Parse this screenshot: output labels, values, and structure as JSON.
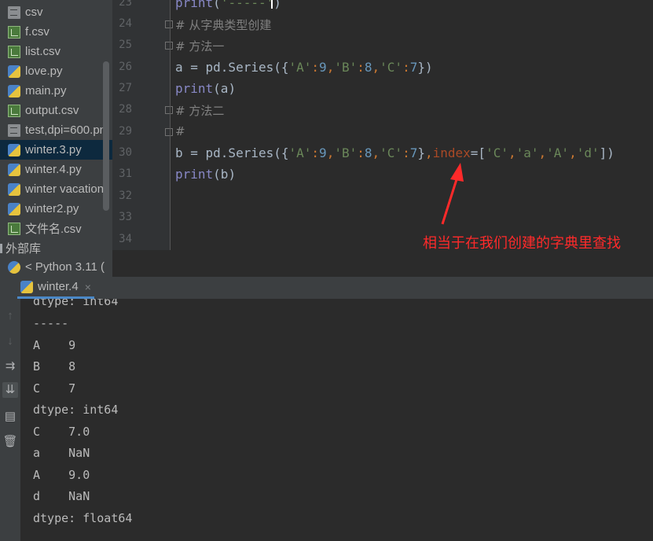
{
  "project_tree": {
    "items": [
      {
        "label": "csv",
        "icon": "csv-file-icon"
      },
      {
        "label": "f.csv",
        "icon": "csv-file-icon"
      },
      {
        "label": "list.csv",
        "icon": "csv-file-icon"
      },
      {
        "label": "love.py",
        "icon": "python-file-icon"
      },
      {
        "label": "main.py",
        "icon": "python-file-icon"
      },
      {
        "label": "output.csv",
        "icon": "csv-file-icon"
      },
      {
        "label": "test,dpi=600.pn",
        "icon": "text-file-icon"
      },
      {
        "label": "winter.3.py",
        "icon": "python-file-icon",
        "selected": true
      },
      {
        "label": "winter.4.py",
        "icon": "python-file-icon"
      },
      {
        "label": "winter vacation",
        "icon": "python-file-icon"
      },
      {
        "label": "winter2.py",
        "icon": "python-file-icon"
      },
      {
        "label": "文件名.csv",
        "icon": "csv-file-icon"
      }
    ],
    "external_libs": "外部库",
    "python_sdk": "< Python 3.11 ("
  },
  "editor": {
    "line_numbers": [
      "23",
      "24",
      "25",
      "26",
      "27",
      "28",
      "29",
      "30",
      "31",
      "32",
      "33",
      "34"
    ],
    "line23": {
      "fn": "print",
      "open": "(",
      "str": "'-----'",
      "close": ")"
    },
    "line24": "# 从字典类型创建",
    "line25": "# 方法一",
    "line26": {
      "lhs": "a = pd.Series({",
      "k1": "'A'",
      "c1": ":",
      "v1": "9",
      "s1": ",",
      "k2": "'B'",
      "c2": ":",
      "v2": "8",
      "s2": ",",
      "k3": "'C'",
      "c3": ":",
      "v3": "7",
      "end": "})"
    },
    "line27": {
      "fn": "print",
      "rest": "(a)"
    },
    "line28": "# 方法二",
    "line29": "#",
    "line30": {
      "lhs": "b = pd.Series({",
      "k1": "'A'",
      "c1": ":",
      "v1": "9",
      "s1": ",",
      "k2": "'B'",
      "c2": ":",
      "v2": "8",
      "s2": ",",
      "k3": "'C'",
      "c3": ":",
      "v3": "7",
      "mid": "}",
      "s3": ",",
      "kw": "index",
      "eq": "=[",
      "i1": "'C'",
      "t1": ",",
      "i2": "'a'",
      "t2": ",",
      "i3": "'A'",
      "t3": ",",
      "i4": "'d'",
      "end": "])"
    },
    "line31": {
      "fn": "print",
      "rest": "(b)"
    },
    "annotation": "相当于在我们创建的字典里查找",
    "annotation_color": "#ff2a2a"
  },
  "run_panel": {
    "tab_label": "winter.4",
    "close_glyph": "×",
    "toolbar": [
      {
        "icon": "arrow-up-icon",
        "glyph": "↑"
      },
      {
        "icon": "arrow-down-icon",
        "glyph": "↓"
      },
      {
        "icon": "soft-wrap-icon",
        "glyph": "⇉"
      },
      {
        "icon": "scroll-to-end-icon",
        "glyph": "⇊"
      },
      {
        "icon": "print-icon",
        "glyph": "▤"
      },
      {
        "icon": "trash-icon",
        "glyph": "🗑"
      }
    ],
    "output_lines": [
      "dtype: int64",
      "-----",
      "A    9",
      "B    8",
      "C    7",
      "dtype: int64",
      "C    7.0",
      "a    NaN",
      "A    9.0",
      "d    NaN",
      "dtype: float64"
    ]
  }
}
